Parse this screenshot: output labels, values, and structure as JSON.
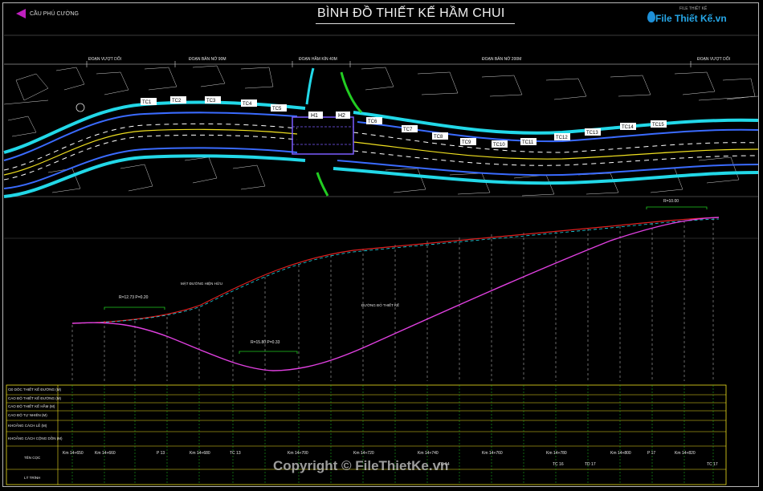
{
  "header": {
    "title": "BÌNH ĐỒ THIẾT KẾ HẦM CHUI",
    "back_label": "CẦU PHÚ CƯỜNG",
    "logo_brand": "File Thiết Kế.vn",
    "logo_sub": "FILE THIẾT KẾ"
  },
  "plan": {
    "segments": [
      "ĐOẠN VƯỢT DỐI",
      "ĐOẠN BẢN NỞ 90M",
      "ĐOẠN HẦM KÍN 40M",
      "ĐOẠN BẢN NỞ 200M",
      "ĐOẠN VƯỢT DỐI"
    ],
    "markers_left": [
      "TC1",
      "TC2",
      "TC3",
      "TC4",
      "TC5"
    ],
    "tunnel_labels": [
      "H1",
      "H2"
    ],
    "markers_right": [
      "TC6",
      "TC7",
      "TC8",
      "TC9",
      "TC10",
      "TC11",
      "TC12",
      "TC13",
      "TC14",
      "TC15"
    ]
  },
  "profile": {
    "curve_labels": [
      "R=12.73 P=0.20",
      "R=15.80 P=0.33",
      "R=10.00"
    ],
    "notes": [
      "MẶT ĐƯỜNG HIỆN HỮU",
      "ĐƯỜNG ĐỎ THIẾT KẾ"
    ]
  },
  "table": {
    "row_labels": [
      "CĐ DÔC THIẾT KẾ ĐƯỜNG (M)",
      "CAO ĐỘ THIẾT KẾ ĐƯỜNG (M)",
      "CAO ĐỘ THIẾT KẾ HẦM (M)",
      "CAO ĐỘ TỰ NHIÊN (M)",
      "KHOẢNG CÁCH LẺ (M)",
      "KHOẢNG CÁCH CỘNG DỒN (M)",
      "TÊN CỌC",
      "LÝ TRÌNH"
    ],
    "stations": [
      "Km 14+650",
      "Km 14+660",
      "P 13",
      "Km 14+680",
      "TC 13",
      "Km 14+700",
      "Km 14+720",
      "Km 14+740",
      "Km 14+760",
      "TD 14",
      "Km 14+780",
      "TC 16",
      "Km 14+800",
      "TD 17",
      "P 17",
      "Km 14+820",
      "TC 17"
    ]
  },
  "watermark": "Copyright © FileThietKe.vn"
}
